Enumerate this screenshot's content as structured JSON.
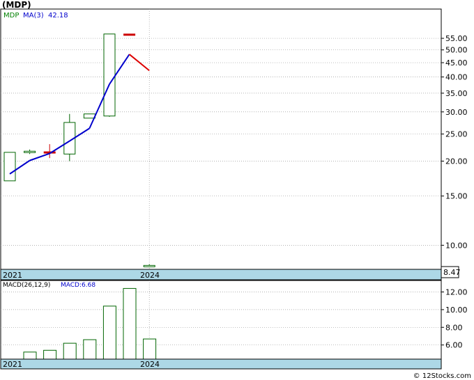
{
  "ticker": "(MDP)",
  "legend": {
    "symbol": "MDP",
    "ma_label": "MA(3)",
    "ma_value": "42.18"
  },
  "macd_legend": {
    "params": "MACD(26,12,9)",
    "value": "MACD:6.68"
  },
  "watermark": "© 12Stocks.com",
  "last_price_label": "8.47",
  "colors": {
    "up_candle": "#006400",
    "down_candle": "#cc0000",
    "ma_line": "#0000cc",
    "ma_line_down": "#dd0000",
    "axis_band": "#add8e6",
    "grid": "#999999",
    "macd_text": "#0000cc",
    "legend_symbol": "#008000"
  },
  "chart_data": [
    {
      "type": "candlestick",
      "scale": "log",
      "ylim": [
        8.2,
        70
      ],
      "price_ticks": [
        "55.00",
        "50.00",
        "45.00",
        "40.00",
        "35.00",
        "30.00",
        "25.00",
        "20.00",
        "15.00",
        "10.00"
      ],
      "price_tick_values": [
        55,
        50,
        45,
        40,
        35,
        30,
        25,
        20,
        15,
        10
      ],
      "x_labels": [
        "2021",
        "2024"
      ],
      "candles": [
        {
          "open": 17,
          "close": 21.5,
          "high": 21.5,
          "low": 17,
          "color": "up"
        },
        {
          "open": 21.5,
          "close": 21.7,
          "high": 22.0,
          "low": 21.2,
          "color": "up"
        },
        {
          "open": 21.4,
          "close": 21.6,
          "high": 23.0,
          "low": 20.5,
          "color": "down"
        },
        {
          "open": 21.2,
          "close": 27.5,
          "high": 29.5,
          "low": 20.0,
          "color": "up"
        },
        {
          "open": 28.5,
          "close": 29.5,
          "high": 29.5,
          "low": 28.5,
          "color": "up"
        },
        {
          "open": 29.0,
          "close": 57.0,
          "high": 57.0,
          "low": 28.8,
          "color": "up"
        },
        {
          "open": 57.0,
          "close": 57.0,
          "high": 57.0,
          "low": 57.0,
          "color": "down"
        },
        {
          "open": 8.47,
          "close": 8.47,
          "high": 8.55,
          "low": 8.4,
          "color": "up"
        }
      ],
      "ma_line": [
        18,
        20.1,
        21.3,
        23.6,
        26.2,
        37.7,
        48.2,
        42.18
      ]
    },
    {
      "type": "bar",
      "title": "MACD(26,12,9)",
      "ylim": [
        4.4,
        13.3
      ],
      "y_ticks": [
        "12.00",
        "10.00",
        "8.00",
        "6.00"
      ],
      "y_tick_values": [
        12,
        10,
        8,
        6
      ],
      "x_labels": [
        "2021",
        "2024"
      ],
      "values": [
        5.2,
        5.4,
        6.2,
        6.6,
        10.4,
        12.4,
        6.68
      ]
    }
  ]
}
